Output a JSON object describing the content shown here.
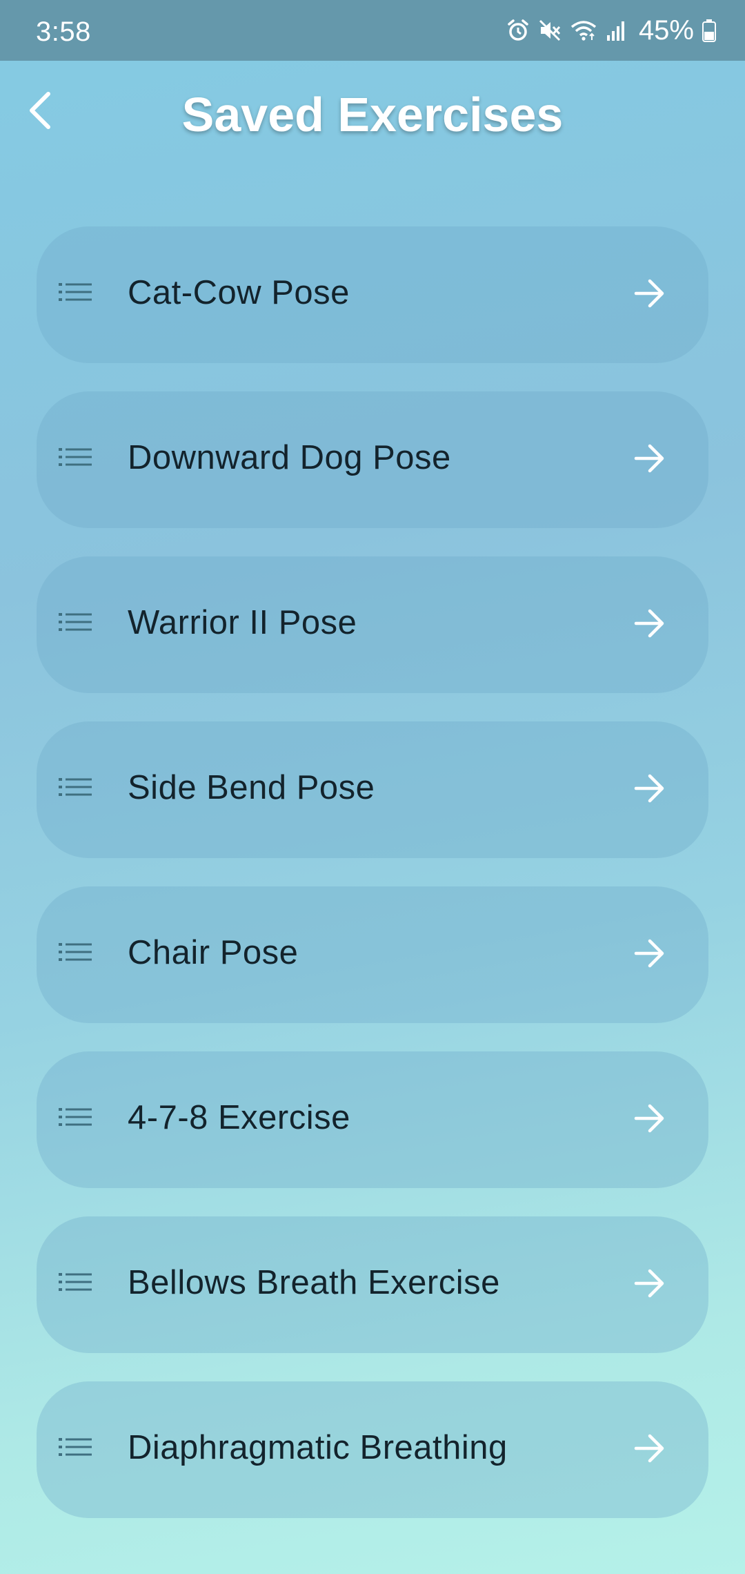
{
  "status_bar": {
    "time": "3:58",
    "battery": "45%",
    "icons": [
      "alarm-icon",
      "mute-icon",
      "wifi-icon",
      "signal-icon",
      "battery-icon"
    ]
  },
  "header": {
    "title": "Saved Exercises",
    "back_icon": "chevron-left-icon"
  },
  "exercises": [
    {
      "label": "Cat-Cow Pose"
    },
    {
      "label": "Downward Dog Pose"
    },
    {
      "label": "Warrior II Pose"
    },
    {
      "label": "Side Bend Pose"
    },
    {
      "label": "Chair Pose"
    },
    {
      "label": "4-7-8 Exercise"
    },
    {
      "label": "Bellows Breath Exercise"
    },
    {
      "label": "Diaphragmatic Breathing"
    }
  ],
  "colors": {
    "status_bar": "#6598ab",
    "gradient_top": "#84cbe3",
    "gradient_bottom": "#b5f1e9",
    "item_text": "#13232c",
    "list_icon": "#3f6f80",
    "arrow": "#ffffff"
  }
}
